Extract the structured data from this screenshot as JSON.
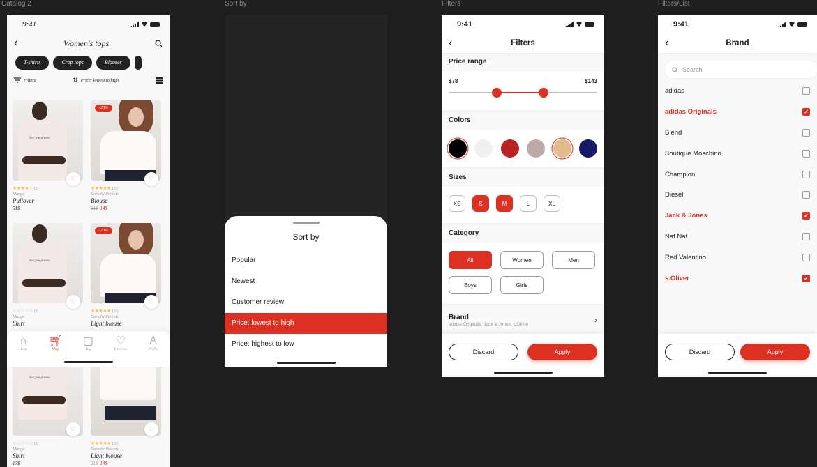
{
  "frames": {
    "catalog": "Catalog 2",
    "sort": "Sort by",
    "filters": "Filters",
    "filters_list": "Filters/List"
  },
  "status": {
    "time": "9:41"
  },
  "catalog": {
    "title": "Women's tops",
    "chips": [
      "T-shirts",
      "Crop tops",
      "Blouses"
    ],
    "filters_label": "Filters",
    "sort_label": "Price: lowest to high",
    "products": [
      {
        "brand": "Mango",
        "name": "Pullover",
        "price": "51$",
        "rating_stars": "★★★★☆",
        "count": "(3)",
        "sale": "",
        "old_price": "",
        "new_price": ""
      },
      {
        "brand": "Dorothy Perkins",
        "name": "Blouse",
        "price": "",
        "rating_stars": "★★★★★",
        "count": "(10)",
        "sale": "-20%",
        "old_price": "21$",
        "new_price": "14$"
      },
      {
        "brand": "Mango",
        "name": "Shirt",
        "price": "",
        "rating_stars": "☆☆☆☆☆",
        "count": "(0)",
        "sale": "",
        "old_price": "",
        "new_price": ""
      },
      {
        "brand": "Dorothy Perkins",
        "name": "Light blouse",
        "price": "",
        "rating_stars": "★★★★★",
        "count": "(10)",
        "sale": "-20%",
        "old_price": "",
        "new_price": ""
      },
      {
        "brand": "Mango",
        "name": "Shirt",
        "price": "17$",
        "rating_stars": "☆☆☆☆☆",
        "count": "(0)",
        "sale": "",
        "old_price": "",
        "new_price": ""
      },
      {
        "brand": "Dorothy Perkins",
        "name": "Light blouse",
        "price": "",
        "rating_stars": "★★★★★",
        "count": "(10)",
        "sale": "",
        "old_price": "21$",
        "new_price": "14$"
      }
    ],
    "tabs": [
      {
        "label": "Home",
        "icon": "home-icon"
      },
      {
        "label": "Shop",
        "icon": "cart-icon"
      },
      {
        "label": "Bag",
        "icon": "bag-icon"
      },
      {
        "label": "Favorites",
        "icon": "heart-icon"
      },
      {
        "label": "Profile",
        "icon": "profile-icon"
      }
    ]
  },
  "sort": {
    "title": "Sort by",
    "options": [
      "Popular",
      "Newest",
      "Customer review",
      "Price: lowest to high",
      "Price: highest to low"
    ],
    "selected_index": 3
  },
  "filters": {
    "title": "Filters",
    "price_title": "Price range",
    "price_min": "$78",
    "price_max": "$143",
    "colors_title": "Colors",
    "colors": [
      "#020202",
      "#f6f6f6",
      "#b82222",
      "#bea9a9",
      "#e2bb8d",
      "#151867"
    ],
    "selected_colors": [
      0,
      4
    ],
    "sizes_title": "Sizes",
    "sizes": [
      "XS",
      "S",
      "M",
      "L",
      "XL"
    ],
    "selected_sizes": [
      1,
      2
    ],
    "category_title": "Category",
    "categories": [
      "All",
      "Women",
      "Men",
      "Boys",
      "Girls"
    ],
    "brand_title": "Brand",
    "brand_summary": "adidas Originals, Jack & Jones, s.Oliver",
    "discard": "Discard",
    "apply": "Apply"
  },
  "brand_list": {
    "title": "Brand",
    "search_placeholder": "Search",
    "brands": [
      {
        "name": "adidas",
        "checked": false
      },
      {
        "name": "adidas Originals",
        "checked": true
      },
      {
        "name": "Blend",
        "checked": false
      },
      {
        "name": "Boutique Moschino",
        "checked": false
      },
      {
        "name": "Champion",
        "checked": false
      },
      {
        "name": "Diesel",
        "checked": false
      },
      {
        "name": "Jack & Jones",
        "checked": true
      },
      {
        "name": "Naf Naf",
        "checked": false
      },
      {
        "name": "Red Valentino",
        "checked": false
      },
      {
        "name": "s.Oliver",
        "checked": true
      }
    ],
    "discard": "Discard",
    "apply": "Apply"
  },
  "colors": {
    "accent": "#db3022",
    "star": "#ffba49",
    "background": "#1e1e1e"
  }
}
